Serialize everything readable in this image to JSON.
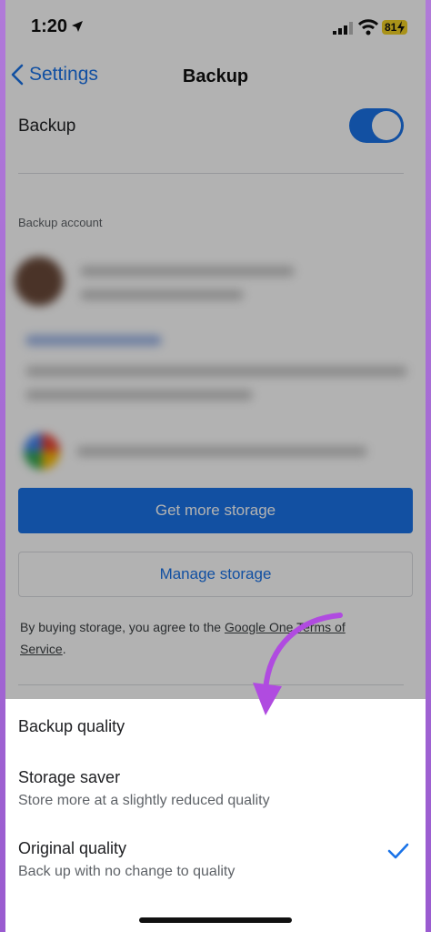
{
  "status_bar": {
    "time": "1:20",
    "battery": "81"
  },
  "nav": {
    "back_label": "Settings",
    "title": "Backup"
  },
  "backup_toggle": {
    "label": "Backup",
    "state": "on"
  },
  "account": {
    "section_label": "Backup account"
  },
  "buttons": {
    "get_more_storage": "Get more storage",
    "manage_storage": "Manage storage"
  },
  "terms": {
    "prefix": "By buying storage, you agree to the ",
    "link": "Google One Terms of Service",
    "suffix": "."
  },
  "sheet": {
    "title": "Backup quality",
    "options": [
      {
        "title": "Storage saver",
        "subtitle": "Store more at a slightly reduced quality",
        "selected": false
      },
      {
        "title": "Original quality",
        "subtitle": "Back up with no change to quality",
        "selected": true
      }
    ]
  },
  "colors": {
    "accent": "#1a73e8",
    "annotation_arrow": "#b04be0",
    "battery": "#f3d224"
  }
}
